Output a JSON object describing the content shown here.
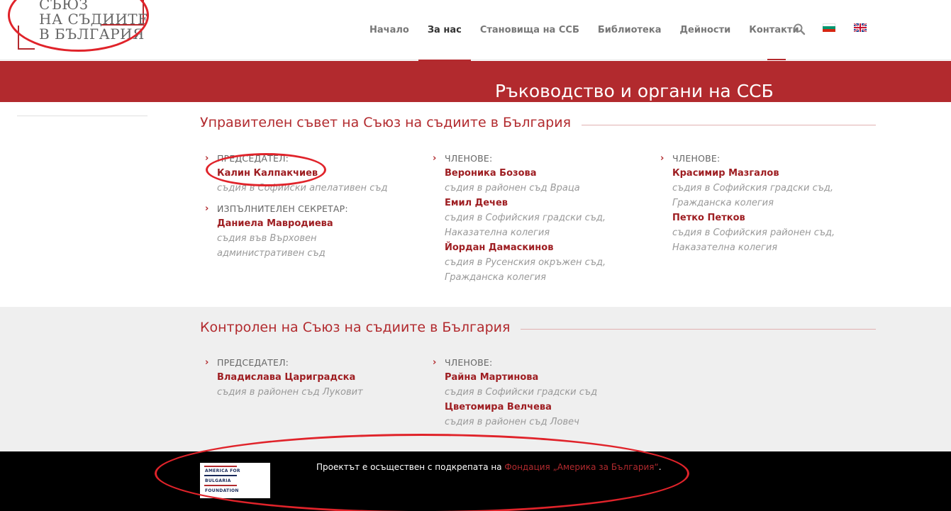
{
  "logo": {
    "line1": "СЪЮЗ",
    "line2": "НА СЪДИИТЕ",
    "line3": "В БЪЛГАРИЯ"
  },
  "nav": {
    "items": [
      "Начало",
      "За нас",
      "Становища на ССБ",
      "Библиотека",
      "Дейности",
      "Контакти"
    ],
    "active": "За нас"
  },
  "header_icons": [
    "search-icon",
    "bulgarian-flag-icon",
    "english-flag-icon"
  ],
  "banner": {
    "title": "Ръководство и органи на ССБ"
  },
  "section1": {
    "title": "Управителен съвет на Съюз на съдиите в България",
    "col1": {
      "e1_role": "ПРЕДСЕДАТЕЛ:",
      "e1_name": "Калин Калпакчиев",
      "e1_desc": "съдия в Софийски апелативен съд",
      "e2_role": "ИЗПЪЛНИТЕЛЕН СЕКРЕТАР:",
      "e2_name": "Даниела Мавродиева",
      "e2_desc1": "съдия във Върховен",
      "e2_desc2": "административен съд"
    },
    "col2": {
      "role": "ЧЛЕНОВЕ:",
      "m1_name": "Вероника Бозова",
      "m1_desc1": "съдия в районен съд Враца",
      "m2_name": "Емил Дечев",
      "m2_desc1": "съдия в Софийския градски съд,",
      "m2_desc2": "Наказателна колегия",
      "m3_name": "Йордан Дамаскинов",
      "m3_desc1": "съдия в Русенския окръжен съд,",
      "m3_desc2": "Гражданска колегия"
    },
    "col3": {
      "role": "ЧЛЕНОВЕ:",
      "m1_name": "Красимир Мазгалов",
      "m1_desc1": "съдия в Софийския градски съд,",
      "m1_desc2": "Гражданска колегия",
      "m2_name": "Петко Петков",
      "m2_desc1": "съдия в Софийския районен съд,",
      "m2_desc2": "Наказателна колегия"
    }
  },
  "section2": {
    "title": "Контролен на Съюз на съдиите в България",
    "col1": {
      "role": "ПРЕДСЕДАТЕЛ:",
      "name": "Владислава Цариградска",
      "desc": "съдия в районен съд Луковит"
    },
    "col2": {
      "role": "ЧЛЕНОВЕ:",
      "m1_name": "Райна Мартинова",
      "m1_desc": "съдия в Софийски градски съд",
      "m2_name": "Цветомира Велчева",
      "m2_desc": "съдия в районен съд Ловеч"
    }
  },
  "footer": {
    "logo_lines": [
      "AMERICA FOR",
      "BULGARIA",
      "FOUNDATION"
    ],
    "text": "Проектът е осъществен с подкрепата на ",
    "link": "Фондация „Америка за България“",
    "suffix": "."
  },
  "colors": {
    "accent": "#b22a2e",
    "footer_bg": "#000000",
    "section_alt_bg": "#efefef",
    "annotation": "#e0232a"
  }
}
